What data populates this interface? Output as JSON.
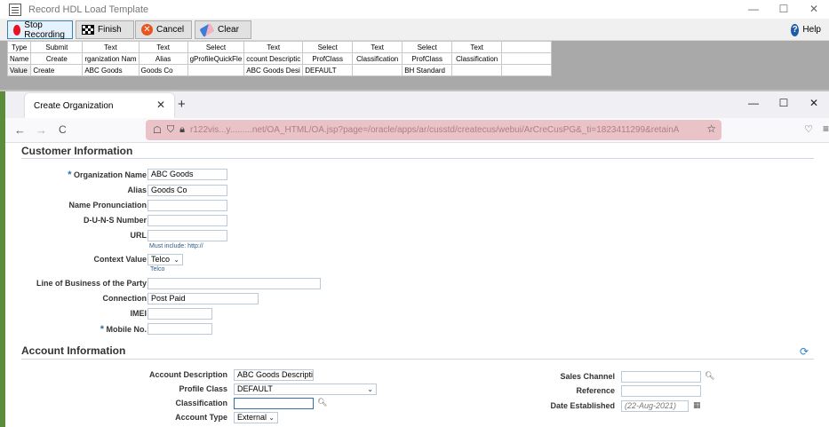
{
  "recorder": {
    "title": "Record HDL Load Template",
    "win_controls": [
      "—",
      "☐",
      "✕"
    ],
    "toolbar": {
      "stop": "Stop Recording",
      "finish": "Finish",
      "cancel": "Cancel",
      "clear": "Clear",
      "help": "Help"
    },
    "grid": {
      "row_labels": [
        "Type",
        "Name",
        "Value"
      ],
      "types": [
        "Submit",
        "Text",
        "Text",
        "Select",
        "Text",
        "Select",
        "Text",
        "Select",
        "Text",
        ""
      ],
      "names": [
        "Create",
        "rganization Nam",
        "Alias",
        "gProfileQuickFle",
        "ccount Descriptic",
        "ProfClass",
        "Classification",
        "ProfClass",
        "Classification",
        ""
      ],
      "values": [
        "Create",
        "ABC Goods",
        "Goods Co",
        "",
        "ABC Goods Desi",
        "DEFAULT",
        "",
        "BH Standard",
        "",
        ""
      ]
    }
  },
  "browser": {
    "tab_title": "Create Organization",
    "tab_close": "✕",
    "new_tab": "+",
    "win_controls": [
      "—",
      "☐",
      "✕"
    ],
    "nav": {
      "back": "←",
      "forward": "→",
      "reload": "C"
    },
    "url": "r122vis...y.........net/OA_HTML/OA.jsp?page=/oracle/apps/ar/cusstd/createcus/webui/ArCreCusPG&_ti=1823411299&retainA"
  },
  "customer": {
    "heading": "Customer Information",
    "org_name_label": "Organization Name",
    "org_name_value": "ABC Goods",
    "alias_label": "Alias",
    "alias_value": "Goods Co",
    "pron_label": "Name Pronunciation",
    "duns_label": "D-U-N-S Number",
    "url_label": "URL",
    "url_hint": "Must include: http://",
    "context_label": "Context Value",
    "context_value": "Telco",
    "context_hint": "Telco",
    "lob_label": "Line of Business of the Party",
    "conn_label": "Connection",
    "conn_value": "Post Paid",
    "imei_label": "IMEI",
    "mobile_label": "Mobile No.",
    "required_mark": "*"
  },
  "account": {
    "heading": "Account Information",
    "desc_label": "Account Description",
    "desc_value": "ABC Goods Descriptic",
    "profile_label": "Profile Class",
    "profile_value": "DEFAULT",
    "class_label": "Classification",
    "class_value": "",
    "type_label": "Account Type",
    "type_value": "External",
    "sales_label": "Sales Channel",
    "ref_label": "Reference",
    "date_label": "Date Established",
    "date_value": "(22-Aug-2021)"
  }
}
